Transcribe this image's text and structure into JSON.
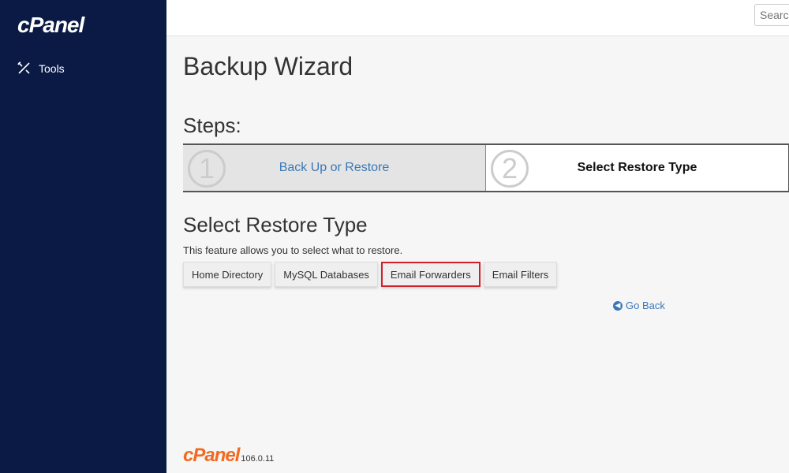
{
  "sidebar": {
    "logo": "cPanel",
    "items": [
      {
        "label": "Tools",
        "icon": "tools-icon"
      }
    ]
  },
  "header": {
    "search_placeholder": "Search"
  },
  "page": {
    "title": "Backup Wizard",
    "steps_title": "Steps:",
    "steps": [
      {
        "number": "1",
        "label": "Back Up or Restore",
        "active": false
      },
      {
        "number": "2",
        "label": "Select Restore Type",
        "active": true
      }
    ],
    "section_title": "Select Restore Type",
    "description": "This feature allows you to select what to restore.",
    "buttons": [
      {
        "label": "Home Directory"
      },
      {
        "label": "MySQL Databases"
      },
      {
        "label": "Email Forwarders",
        "highlighted": true
      },
      {
        "label": "Email Filters"
      }
    ],
    "go_back": "Go Back"
  },
  "footer": {
    "logo": "cPanel",
    "version": "106.0.11"
  },
  "colors": {
    "sidebar": "#0a1a45",
    "link": "#3a78b5",
    "highlight": "#d0202a",
    "brand": "#f26a21"
  }
}
